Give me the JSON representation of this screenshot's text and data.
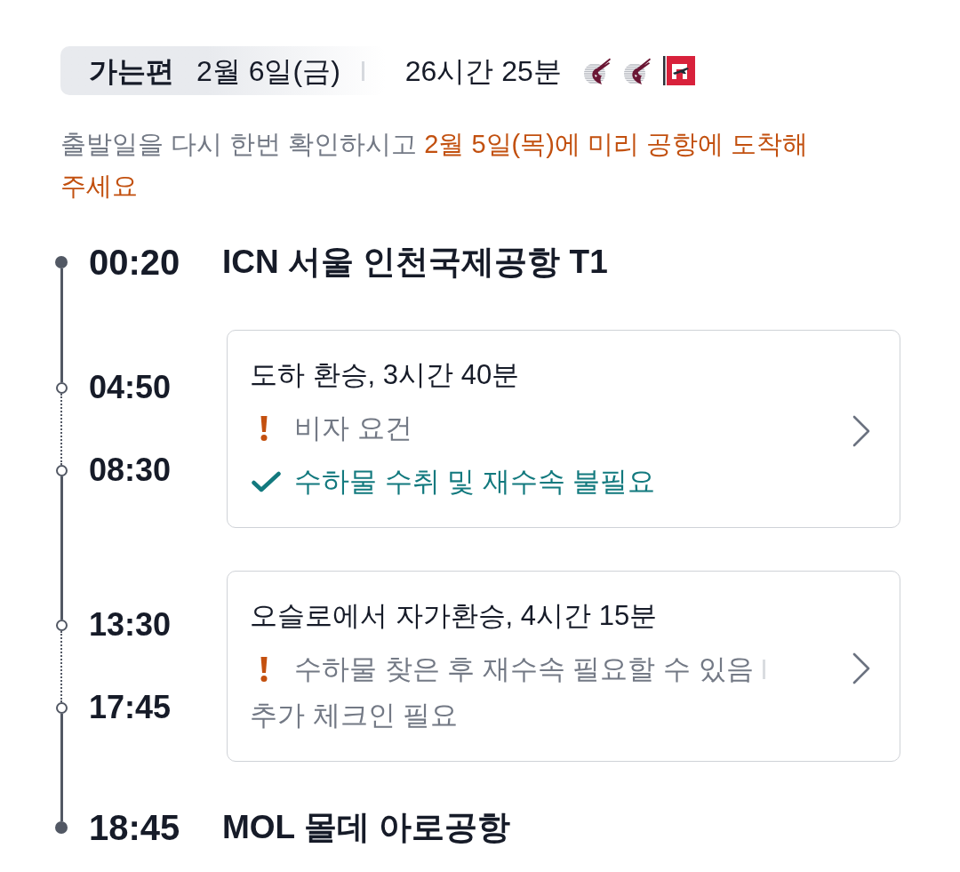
{
  "header": {
    "label": "가는편",
    "date": "2월 6일(금)",
    "duration": "26시간 25분",
    "airline_logos": [
      {
        "kind": "circle"
      },
      {
        "kind": "circle"
      },
      {
        "kind": "square"
      }
    ]
  },
  "notice": {
    "text": "출발일을 다시 한번 확인하시고",
    "highlight": "2월 5일(목)에 미리 공항에 도착해 주세요"
  },
  "timeline": [
    {
      "kind": "stop",
      "time": "00:20",
      "place": "ICN 서울 인천국제공항 T1"
    },
    {
      "kind": "layover",
      "arrive": "04:50",
      "depart": "08:30",
      "title": "도하 환승, 3시간 40분",
      "warnings": [
        "비자 요건"
      ],
      "confirmations": [
        "수하물 수취 및 재수속 불필요"
      ]
    },
    {
      "kind": "layover",
      "arrive": "13:30",
      "depart": "17:45",
      "title": "오슬로에서 자가환승, 4시간 15분",
      "warnings": [
        "수하물 찾은 후 재수속 필요할 수 있음",
        "추가 체크인 필요"
      ]
    },
    {
      "kind": "stop",
      "time": "18:45",
      "place": "MOL 몰데 아로공항"
    }
  ]
}
